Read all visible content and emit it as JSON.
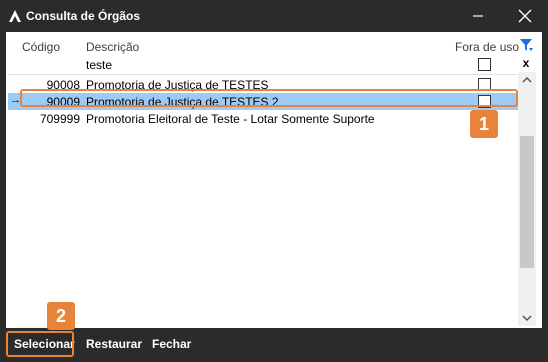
{
  "window": {
    "title": "Consulta de Órgãos",
    "icons": {
      "app": "app-logo-icon",
      "minimize": "minimize-icon",
      "close": "close-icon"
    }
  },
  "grid": {
    "columns": {
      "codigo": "Código",
      "descricao": "Descrição",
      "fora_de_uso": "Fora de uso"
    },
    "filter": {
      "descricao": "teste",
      "fora_de_uso": false
    },
    "rows": [
      {
        "codigo": "90008",
        "descricao": "Promotoria de Justiça de TESTES",
        "fora_de_uso": false,
        "selected": false
      },
      {
        "codigo": "90009",
        "descricao": "Promotoria de Justiça de TESTES 2",
        "fora_de_uso": false,
        "selected": true
      },
      {
        "codigo": "709999",
        "descricao": "Promotoria Eleitoral de Teste - Lotar Somente Suporte",
        "fora_de_uso": false,
        "selected": false
      }
    ],
    "current_row_indicator": "→"
  },
  "toolbar": {
    "filter_icon": "filter-icon",
    "clear_filter": "x"
  },
  "annotations": {
    "badge_1": "1",
    "badge_2": "2"
  },
  "bottom": {
    "selecionar": "Selecionar",
    "restaurar": "Restaurar",
    "fechar": "Fechar"
  },
  "colors": {
    "accent": "#e8843a",
    "selected_row": "#9ecbf5",
    "chrome": "#2b2b2b"
  }
}
